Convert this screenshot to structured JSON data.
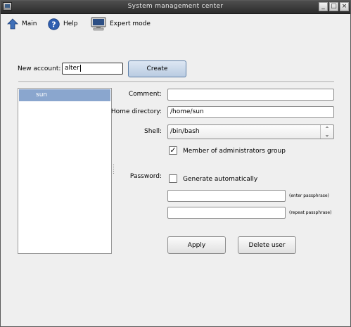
{
  "window": {
    "title": "System management center",
    "controls": [
      "minimize",
      "maximize",
      "close"
    ]
  },
  "toolbar": {
    "items": [
      {
        "label": "Main",
        "icon": "up-arrow-icon"
      },
      {
        "label": "Help",
        "icon": "help-icon"
      },
      {
        "label": "Expert mode",
        "icon": "monitor-icon"
      }
    ]
  },
  "new_account": {
    "label": "New account:",
    "value": "alter",
    "create_label": "Create"
  },
  "users": {
    "items": [
      "sun"
    ],
    "selected": "sun",
    "selection_color": "#8aa6ce"
  },
  "details": {
    "comment_label": "Comment:",
    "comment_value": "",
    "home_label": "Home directory:",
    "home_value": "/home/sun",
    "shell_label": "Shell:",
    "shell_value": "/bin/bash",
    "admin_label": "Member of administrators group",
    "admin_checked": true,
    "password_label": "Password:",
    "generate_label": "Generate automatically",
    "generate_checked": false,
    "enter_note": "(enter passphrase)",
    "repeat_note": "(repeat passphrase)",
    "apply_label": "Apply",
    "delete_label": "Delete user"
  }
}
